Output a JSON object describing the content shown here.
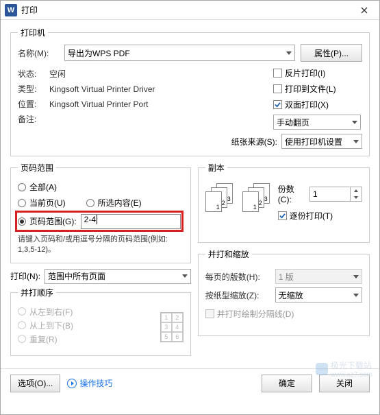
{
  "title": "打印",
  "printer": {
    "legend": "打印机",
    "name_label": "名称(M):",
    "name_value": "导出为WPS PDF",
    "properties_btn": "属性(P)...",
    "status_label": "状态:",
    "status_value": "空闲",
    "reverse_label": "反片打印(I)",
    "type_label": "类型:",
    "type_value": "Kingsoft Virtual Printer Driver",
    "tofile_label": "打印到文件(L)",
    "port_label": "位置:",
    "port_value": "Kingsoft Virtual Printer Port",
    "duplex_label": "双面打印(X)",
    "comment_label": "备注:",
    "comment_value": "",
    "flip_value": "手动翻页",
    "paper_label": "纸张来源(S):",
    "paper_value": "使用打印机设置"
  },
  "range": {
    "legend": "页码范围",
    "all": "全部(A)",
    "current": "当前页(U)",
    "selection": "所选内容(E)",
    "pages_label": "页码范围(G):",
    "pages_value": "2-4",
    "hint": "请键入页码和/或用逗号分隔的页码范围(例如: 1,3,5-12)。"
  },
  "copies": {
    "legend": "副本",
    "copies_label": "份数(C):",
    "copies_value": "1",
    "collate_label": "逐份打印(T)",
    "pages_back": [
      "3",
      "2",
      "1"
    ]
  },
  "print_what": {
    "label": "打印(N):",
    "value": "范围中所有页面"
  },
  "merge": {
    "legend": "并打和缩放",
    "per_page_label": "每页的版数(H):",
    "per_page_value": "1 版",
    "scale_label": "按纸型缩放(Z):",
    "scale_value": "无缩放",
    "draw_lines_label": "并打时绘制分隔线(D)"
  },
  "order": {
    "legend": "并打顺序",
    "lr": "从左到右(F)",
    "tb": "从上到下(B)",
    "repeat": "重复(R)",
    "cells": [
      "1",
      "2",
      "3",
      "4",
      "5",
      "6"
    ]
  },
  "footer": {
    "options": "选项(O)...",
    "tips": "操作技巧",
    "ok": "确定",
    "cancel": "关闭"
  },
  "watermark": {
    "text": "极光下载站",
    "url": "www.xz7.com"
  }
}
